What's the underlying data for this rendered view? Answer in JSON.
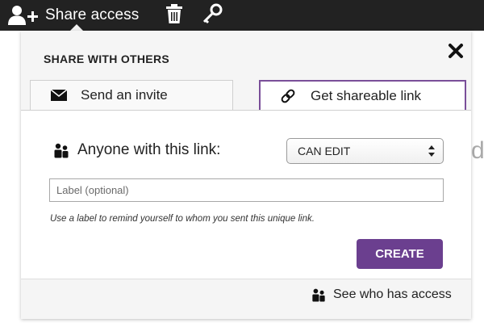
{
  "toolbar": {
    "share_access_label": "Share access",
    "icons": [
      "user-plus-icon",
      "trash-icon",
      "key-icon"
    ]
  },
  "background": {
    "partial_letter": "d"
  },
  "dialog": {
    "title": "SHARE WITH OTHERS",
    "close_icon": "close-icon",
    "tabs": [
      {
        "label": "Send an invite",
        "icon": "envelope-icon",
        "active": false
      },
      {
        "label": "Get shareable link",
        "icon": "link-icon",
        "active": true
      }
    ],
    "anyone_label": "Anyone with this link:",
    "permission": {
      "selected": "CAN EDIT"
    },
    "label_input": {
      "value": "",
      "placeholder": "Label (optional)"
    },
    "hint": "Use a label to remind yourself to whom you sent this unique link.",
    "create_label": "CREATE",
    "see_who_label": "See who has access"
  },
  "colors": {
    "toolbar_bg": "#222222",
    "accent": "#6b3f8f",
    "active_tab_border": "#7a4f99",
    "dialog_bg": "#f5f5f5"
  }
}
